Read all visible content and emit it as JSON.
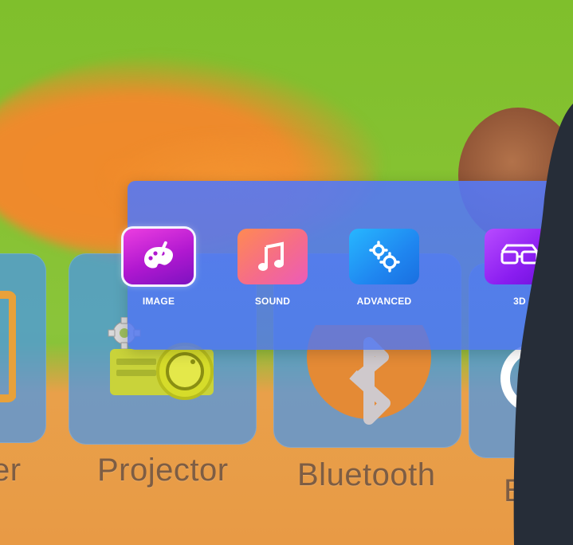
{
  "launcher": {
    "tiles": [
      {
        "label": "er"
      },
      {
        "label": "Projector"
      },
      {
        "label": "Bluetooth"
      },
      {
        "label": "B"
      }
    ]
  },
  "settings_menu": {
    "items": [
      {
        "label": "IMAGE",
        "icon": "paint-palette-icon",
        "selected": true,
        "color": "#b018d0"
      },
      {
        "label": "SOUND",
        "icon": "music-note-icon",
        "color": "#f56c8a"
      },
      {
        "label": "ADVANCED",
        "icon": "gears-icon",
        "color": "#1f86f0"
      },
      {
        "label": "3D",
        "icon": "3d-glasses-icon",
        "color": "#8a1df0"
      }
    ]
  },
  "colors": {
    "panel": "#5578f5",
    "tile": "#4696eb",
    "label_text": "#7d5d44",
    "dark_edge": "#262d38"
  }
}
